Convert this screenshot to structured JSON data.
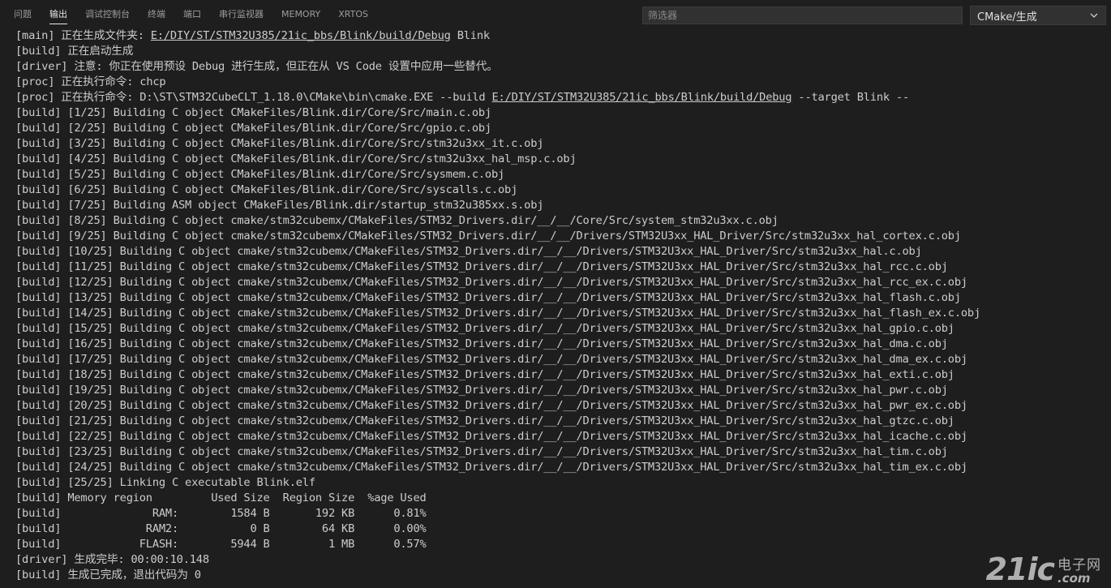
{
  "panel": {
    "tabs": [
      {
        "label": "问题",
        "active": false
      },
      {
        "label": "输出",
        "active": true
      },
      {
        "label": "调试控制台",
        "active": false
      },
      {
        "label": "终端",
        "active": false
      },
      {
        "label": "端口",
        "active": false
      },
      {
        "label": "串行监视器",
        "active": false
      },
      {
        "label": "MEMORY",
        "active": false
      },
      {
        "label": "XRTOS",
        "active": false
      }
    ],
    "filter": {
      "placeholder": "筛选器",
      "value": ""
    },
    "channel": {
      "selected": "CMake/生成"
    }
  },
  "output": {
    "lines": [
      {
        "segments": [
          {
            "text": "[main] 正在生成文件夹: "
          },
          {
            "text": "E:/DIY/ST/STM32U385/21ic_bbs/Blink/build/Debug",
            "link": true
          },
          {
            "text": " Blink"
          }
        ]
      },
      {
        "segments": [
          {
            "text": "[build] 正在启动生成"
          }
        ]
      },
      {
        "segments": [
          {
            "text": "[driver] 注意: 你正在使用预设 Debug 进行生成，但正在从 VS Code 设置中应用一些替代。"
          }
        ]
      },
      {
        "segments": [
          {
            "text": "[proc] 正在执行命令: chcp"
          }
        ]
      },
      {
        "segments": [
          {
            "text": "[proc] 正在执行命令: D:\\ST\\STM32CubeCLT_1.18.0\\CMake\\bin\\cmake.EXE --build "
          },
          {
            "text": "E:/DIY/ST/STM32U385/21ic_bbs/Blink/build/Debug",
            "link": true
          },
          {
            "text": " --target Blink --"
          }
        ]
      },
      {
        "segments": [
          {
            "text": "[build] [1/25] Building C object CMakeFiles/Blink.dir/Core/Src/main.c.obj"
          }
        ]
      },
      {
        "segments": [
          {
            "text": "[build] [2/25] Building C object CMakeFiles/Blink.dir/Core/Src/gpio.c.obj"
          }
        ]
      },
      {
        "segments": [
          {
            "text": "[build] [3/25] Building C object CMakeFiles/Blink.dir/Core/Src/stm32u3xx_it.c.obj"
          }
        ]
      },
      {
        "segments": [
          {
            "text": "[build] [4/25] Building C object CMakeFiles/Blink.dir/Core/Src/stm32u3xx_hal_msp.c.obj"
          }
        ]
      },
      {
        "segments": [
          {
            "text": "[build] [5/25] Building C object CMakeFiles/Blink.dir/Core/Src/sysmem.c.obj"
          }
        ]
      },
      {
        "segments": [
          {
            "text": "[build] [6/25] Building C object CMakeFiles/Blink.dir/Core/Src/syscalls.c.obj"
          }
        ]
      },
      {
        "segments": [
          {
            "text": "[build] [7/25] Building ASM object CMakeFiles/Blink.dir/startup_stm32u385xx.s.obj"
          }
        ]
      },
      {
        "segments": [
          {
            "text": "[build] [8/25] Building C object cmake/stm32cubemx/CMakeFiles/STM32_Drivers.dir/__/__/Core/Src/system_stm32u3xx.c.obj"
          }
        ]
      },
      {
        "segments": [
          {
            "text": "[build] [9/25] Building C object cmake/stm32cubemx/CMakeFiles/STM32_Drivers.dir/__/__/Drivers/STM32U3xx_HAL_Driver/Src/stm32u3xx_hal_cortex.c.obj"
          }
        ]
      },
      {
        "segments": [
          {
            "text": "[build] [10/25] Building C object cmake/stm32cubemx/CMakeFiles/STM32_Drivers.dir/__/__/Drivers/STM32U3xx_HAL_Driver/Src/stm32u3xx_hal.c.obj"
          }
        ]
      },
      {
        "segments": [
          {
            "text": "[build] [11/25] Building C object cmake/stm32cubemx/CMakeFiles/STM32_Drivers.dir/__/__/Drivers/STM32U3xx_HAL_Driver/Src/stm32u3xx_hal_rcc.c.obj"
          }
        ]
      },
      {
        "segments": [
          {
            "text": "[build] [12/25] Building C object cmake/stm32cubemx/CMakeFiles/STM32_Drivers.dir/__/__/Drivers/STM32U3xx_HAL_Driver/Src/stm32u3xx_hal_rcc_ex.c.obj"
          }
        ]
      },
      {
        "segments": [
          {
            "text": "[build] [13/25] Building C object cmake/stm32cubemx/CMakeFiles/STM32_Drivers.dir/__/__/Drivers/STM32U3xx_HAL_Driver/Src/stm32u3xx_hal_flash.c.obj"
          }
        ]
      },
      {
        "segments": [
          {
            "text": "[build] [14/25] Building C object cmake/stm32cubemx/CMakeFiles/STM32_Drivers.dir/__/__/Drivers/STM32U3xx_HAL_Driver/Src/stm32u3xx_hal_flash_ex.c.obj"
          }
        ]
      },
      {
        "segments": [
          {
            "text": "[build] [15/25] Building C object cmake/stm32cubemx/CMakeFiles/STM32_Drivers.dir/__/__/Drivers/STM32U3xx_HAL_Driver/Src/stm32u3xx_hal_gpio.c.obj"
          }
        ]
      },
      {
        "segments": [
          {
            "text": "[build] [16/25] Building C object cmake/stm32cubemx/CMakeFiles/STM32_Drivers.dir/__/__/Drivers/STM32U3xx_HAL_Driver/Src/stm32u3xx_hal_dma.c.obj"
          }
        ]
      },
      {
        "segments": [
          {
            "text": "[build] [17/25] Building C object cmake/stm32cubemx/CMakeFiles/STM32_Drivers.dir/__/__/Drivers/STM32U3xx_HAL_Driver/Src/stm32u3xx_hal_dma_ex.c.obj"
          }
        ]
      },
      {
        "segments": [
          {
            "text": "[build] [18/25] Building C object cmake/stm32cubemx/CMakeFiles/STM32_Drivers.dir/__/__/Drivers/STM32U3xx_HAL_Driver/Src/stm32u3xx_hal_exti.c.obj"
          }
        ]
      },
      {
        "segments": [
          {
            "text": "[build] [19/25] Building C object cmake/stm32cubemx/CMakeFiles/STM32_Drivers.dir/__/__/Drivers/STM32U3xx_HAL_Driver/Src/stm32u3xx_hal_pwr.c.obj"
          }
        ]
      },
      {
        "segments": [
          {
            "text": "[build] [20/25] Building C object cmake/stm32cubemx/CMakeFiles/STM32_Drivers.dir/__/__/Drivers/STM32U3xx_HAL_Driver/Src/stm32u3xx_hal_pwr_ex.c.obj"
          }
        ]
      },
      {
        "segments": [
          {
            "text": "[build] [21/25] Building C object cmake/stm32cubemx/CMakeFiles/STM32_Drivers.dir/__/__/Drivers/STM32U3xx_HAL_Driver/Src/stm32u3xx_hal_gtzc.c.obj"
          }
        ]
      },
      {
        "segments": [
          {
            "text": "[build] [22/25] Building C object cmake/stm32cubemx/CMakeFiles/STM32_Drivers.dir/__/__/Drivers/STM32U3xx_HAL_Driver/Src/stm32u3xx_hal_icache.c.obj"
          }
        ]
      },
      {
        "segments": [
          {
            "text": "[build] [23/25] Building C object cmake/stm32cubemx/CMakeFiles/STM32_Drivers.dir/__/__/Drivers/STM32U3xx_HAL_Driver/Src/stm32u3xx_hal_tim.c.obj"
          }
        ]
      },
      {
        "segments": [
          {
            "text": "[build] [24/25] Building C object cmake/stm32cubemx/CMakeFiles/STM32_Drivers.dir/__/__/Drivers/STM32U3xx_HAL_Driver/Src/stm32u3xx_hal_tim_ex.c.obj"
          }
        ]
      },
      {
        "segments": [
          {
            "text": "[build] [25/25] Linking C executable Blink.elf"
          }
        ]
      },
      {
        "segments": [
          {
            "text": "[build] Memory region         Used Size  Region Size  %age Used"
          }
        ]
      },
      {
        "segments": [
          {
            "text": "[build]              RAM:        1584 B       192 KB      0.81%"
          }
        ]
      },
      {
        "segments": [
          {
            "text": "[build]             RAM2:           0 B        64 KB      0.00%"
          }
        ]
      },
      {
        "segments": [
          {
            "text": "[build]            FLASH:        5944 B         1 MB      0.57%"
          }
        ]
      },
      {
        "segments": [
          {
            "text": "[driver] 生成完毕: 00:00:10.148"
          }
        ]
      },
      {
        "segments": [
          {
            "text": "[build] 生成已完成，退出代码为 0"
          }
        ]
      }
    ]
  },
  "watermark": {
    "logo": "21ic",
    "cn": "电子网",
    "com": ".com"
  },
  "colors": {
    "background": "#1e1e1e",
    "text": "#cccccc",
    "input_bg": "#313131"
  },
  "icons": {
    "channel_dropdown": "chevron-down-icon"
  }
}
